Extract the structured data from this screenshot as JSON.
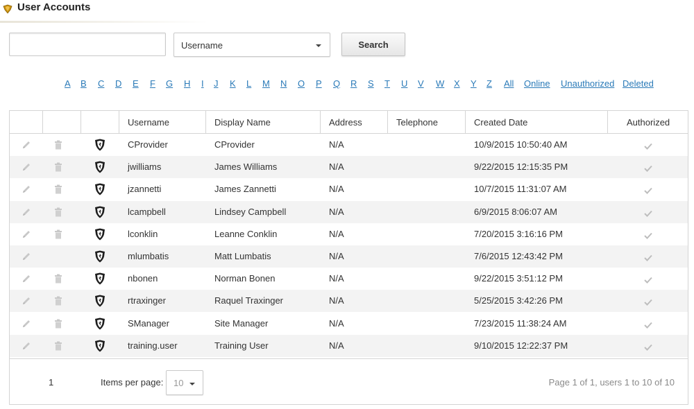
{
  "header": {
    "title": "User Accounts",
    "icon": "module-icon",
    "colors": {
      "icon": "#c9930f"
    }
  },
  "search": {
    "input_value": "",
    "input_placeholder": "",
    "field_selected": "Username",
    "button_label": "Search"
  },
  "alpha_nav": {
    "letters": [
      "A",
      "B",
      "C",
      "D",
      "E",
      "F",
      "G",
      "H",
      "I",
      "J",
      "K",
      "L",
      "M",
      "N",
      "O",
      "P",
      "Q",
      "R",
      "S",
      "T",
      "U",
      "V",
      "W",
      "X",
      "Y",
      "Z"
    ],
    "extra": [
      "All",
      "Online",
      "Unauthorized",
      "Deleted"
    ],
    "link_color": "#2a7ab8"
  },
  "grid": {
    "columns": [
      "",
      "",
      "",
      "Username",
      "Display Name",
      "Address",
      "Telephone",
      "Created Date",
      "Authorized"
    ],
    "rows": [
      {
        "username": "CProvider",
        "display_name": "CProvider",
        "address": "N/A",
        "telephone": "",
        "created": "10/9/2015 10:50:40 AM",
        "authorized": true,
        "deletable": true
      },
      {
        "username": "jwilliams",
        "display_name": "James Williams",
        "address": "N/A",
        "telephone": "",
        "created": "9/22/2015 12:15:35 PM",
        "authorized": true,
        "deletable": true
      },
      {
        "username": "jzannetti",
        "display_name": "James Zannetti",
        "address": "N/A",
        "telephone": "",
        "created": "10/7/2015 11:31:07 AM",
        "authorized": true,
        "deletable": true
      },
      {
        "username": "lcampbell",
        "display_name": "Lindsey Campbell",
        "address": "N/A",
        "telephone": "",
        "created": "6/9/2015 8:06:07 AM",
        "authorized": true,
        "deletable": true
      },
      {
        "username": "lconklin",
        "display_name": "Leanne Conklin",
        "address": "N/A",
        "telephone": "",
        "created": "7/20/2015 3:16:16 PM",
        "authorized": true,
        "deletable": true
      },
      {
        "username": "mlumbatis",
        "display_name": "Matt Lumbatis",
        "address": "N/A",
        "telephone": "",
        "created": "7/6/2015 12:43:42 PM",
        "authorized": true,
        "deletable": false
      },
      {
        "username": "nbonen",
        "display_name": "Norman Bonen",
        "address": "N/A",
        "telephone": "",
        "created": "9/22/2015 3:51:12 PM",
        "authorized": true,
        "deletable": true
      },
      {
        "username": "rtraxinger",
        "display_name": "Raquel Traxinger",
        "address": "N/A",
        "telephone": "",
        "created": "5/25/2015 3:42:26 PM",
        "authorized": true,
        "deletable": true
      },
      {
        "username": "SManager",
        "display_name": "Site Manager",
        "address": "N/A",
        "telephone": "",
        "created": "7/23/2015 11:38:24 AM",
        "authorized": true,
        "deletable": true
      },
      {
        "username": "training.user",
        "display_name": "Training User",
        "address": "N/A",
        "telephone": "",
        "created": "9/10/2015 12:22:37 PM",
        "authorized": true,
        "deletable": true
      }
    ],
    "row_icons": {
      "edit": "pencil-icon",
      "delete": "trash-icon",
      "role": "shield-icon",
      "authorized": "checkmark-icon"
    }
  },
  "footer": {
    "page_number": "1",
    "items_per_page_label": "Items per page:",
    "items_per_page_value": "10",
    "page_info": "Page 1 of 1, users 1 to 10 of 10"
  }
}
